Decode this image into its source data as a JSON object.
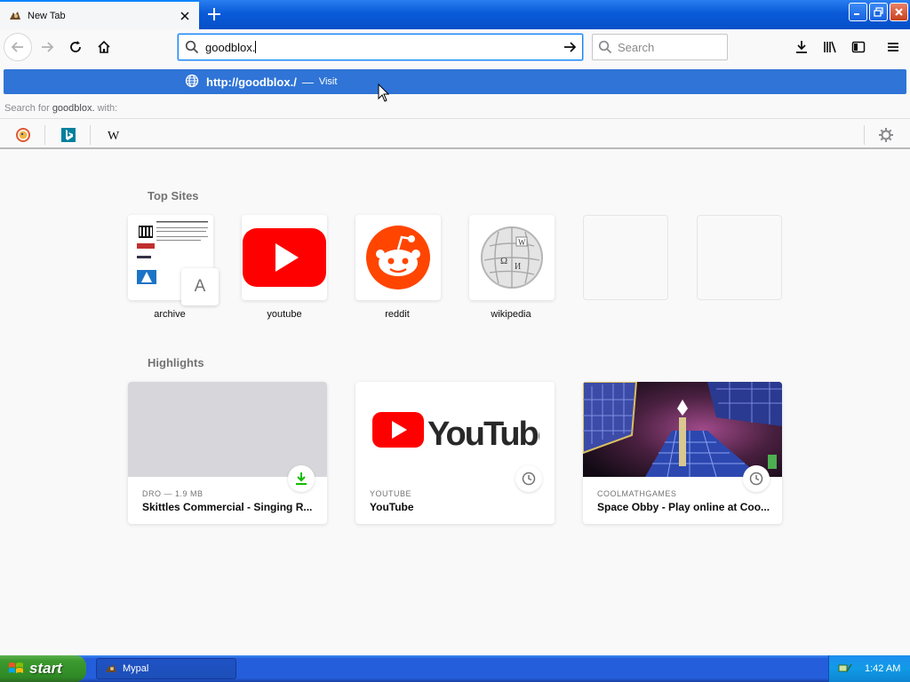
{
  "colors": {
    "accent": "#0a84ff",
    "highlight_row": "#2f74d6",
    "taskbar": "#245edb",
    "start_green": "#3c9a2f"
  },
  "tab": {
    "title": "New Tab",
    "favicon": "mypal-icon",
    "close": "close-icon"
  },
  "new_tab_icon": "plus-icon",
  "nav": {
    "back": "back-arrow-icon",
    "forward": "forward-arrow-icon",
    "reload": "reload-icon",
    "home": "home-icon"
  },
  "urlbar": {
    "value": "goodblox."
  },
  "searchbar": {
    "placeholder": "Search"
  },
  "toolbar_icons": [
    "download-icon",
    "library-icon",
    "sidebar-icon",
    "menu-icon"
  ],
  "dropdown": {
    "url": "http://goodblox./",
    "separator": "—",
    "action": "Visit",
    "search_prefix": "Search for ",
    "search_term": "goodblox.",
    "search_suffix": " with:",
    "engines": [
      "duckduckgo-icon",
      "bing-icon",
      "wikipedia-icon"
    ]
  },
  "topsites": {
    "heading": "Top Sites",
    "items": [
      {
        "label": "archive",
        "letter": "A"
      },
      {
        "label": "youtube"
      },
      {
        "label": "reddit"
      },
      {
        "label": "wikipedia"
      },
      {
        "label": ""
      },
      {
        "label": ""
      }
    ]
  },
  "archive_thumb_lines": [
    "Temporarily Offline"
  ],
  "highlights": {
    "heading": "Highlights",
    "cards": [
      {
        "host": "DRO — 1.9 MB",
        "title": "Skittles Commercial - Singing R...",
        "badge": "download-icon"
      },
      {
        "host": "YOUTUBE",
        "title": "YouTube",
        "logo": "YouTube",
        "badge": "clock-icon"
      },
      {
        "host": "COOLMATHGAMES",
        "title": "Space Obby - Play online at Coo...",
        "badge": "clock-icon"
      }
    ]
  },
  "taskbar": {
    "start": "start",
    "task": "Mypal",
    "time": "1:42 AM"
  }
}
